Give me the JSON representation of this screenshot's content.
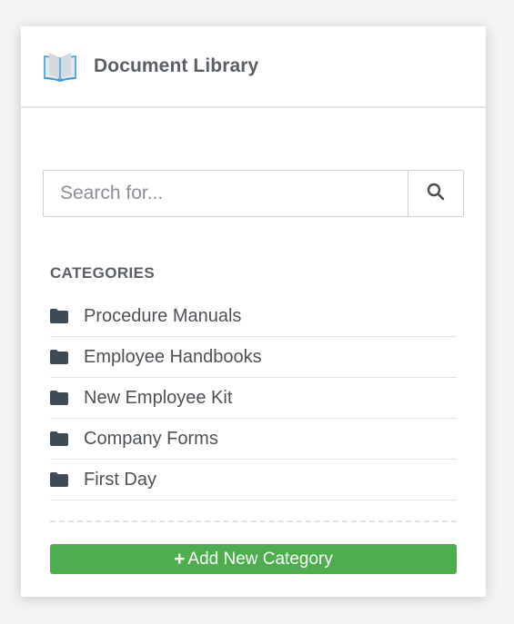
{
  "header": {
    "title": "Document Library",
    "icon": "book-icon"
  },
  "search": {
    "placeholder": "Search for...",
    "value": "",
    "button_icon": "search-icon"
  },
  "categories": {
    "heading": "CATEGORIES",
    "items": [
      {
        "label": "Procedure Manuals",
        "icon": "folder-icon"
      },
      {
        "label": "Employee Handbooks",
        "icon": "folder-icon"
      },
      {
        "label": "New Employee Kit",
        "icon": "folder-icon"
      },
      {
        "label": "Company Forms",
        "icon": "folder-icon"
      },
      {
        "label": "First Day",
        "icon": "folder-icon"
      }
    ]
  },
  "add_button": {
    "label": "Add New Category",
    "icon": "plus-icon"
  },
  "colors": {
    "accent_green": "#4cae4c",
    "folder": "#3f4a57",
    "book_blue": "#3a9bd9"
  }
}
